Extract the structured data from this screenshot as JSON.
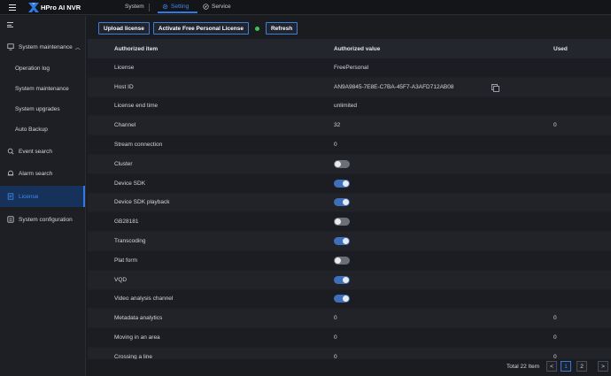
{
  "header": {
    "app_title": "HPro AI NVR",
    "nav": {
      "system": "System",
      "setting": "Setting",
      "service": "Service"
    }
  },
  "sidebar": {
    "items": [
      {
        "label": "System maintenance",
        "icon": "maintenance-icon",
        "expanded": true
      },
      {
        "label": "Operation log"
      },
      {
        "label": "System maintenance"
      },
      {
        "label": "System upgrades"
      },
      {
        "label": "Auto Backup"
      },
      {
        "label": "Event search",
        "icon": "event-icon"
      },
      {
        "label": "Alarm search",
        "icon": "alarm-icon"
      },
      {
        "label": "License",
        "icon": "license-icon",
        "active": true
      },
      {
        "label": "System configuration",
        "icon": "config-icon"
      }
    ]
  },
  "toolbar": {
    "upload": "Upload license",
    "activate": "Activate Free Personal License",
    "status_color": "#3cc256",
    "refresh": "Refresh"
  },
  "table": {
    "headers": [
      "Authorized item",
      "Authorized value",
      "Used"
    ],
    "rows": [
      {
        "item": "License",
        "value": "FreePersonal",
        "used": ""
      },
      {
        "item": "Host ID",
        "value": "AN9A9845-7E8E-C7BA-45F7-A3AFD712AB08",
        "used": "",
        "copy": true
      },
      {
        "item": "License end time",
        "value": "unlimited",
        "used": ""
      },
      {
        "item": "Channel",
        "value": "32",
        "used": "0"
      },
      {
        "item": "Stream connection",
        "value": "0",
        "used": ""
      },
      {
        "item": "Cluster",
        "toggle": false
      },
      {
        "item": "Device SDK",
        "toggle": true
      },
      {
        "item": "Device SDK playback",
        "toggle": true
      },
      {
        "item": "GB28181",
        "toggle": false
      },
      {
        "item": "Transcoding",
        "toggle": true
      },
      {
        "item": "Plat form",
        "toggle": false
      },
      {
        "item": "VQD",
        "toggle": true
      },
      {
        "item": "Video analysis channel",
        "toggle": true
      },
      {
        "item": "Metadata analytics",
        "value": "0",
        "used": "0"
      },
      {
        "item": "Moving in an area",
        "value": "0",
        "used": "0"
      },
      {
        "item": "Crossing a line",
        "value": "0",
        "used": "0"
      }
    ]
  },
  "pagination": {
    "total": "Total 22 Item",
    "prev": "<",
    "pages": [
      "1",
      "2"
    ],
    "current": "1",
    "next": ">"
  },
  "colors": {
    "accent": "#2f7ae5",
    "toggle_on": "#3f6fb8",
    "toggle_off": "#6c6f76"
  }
}
